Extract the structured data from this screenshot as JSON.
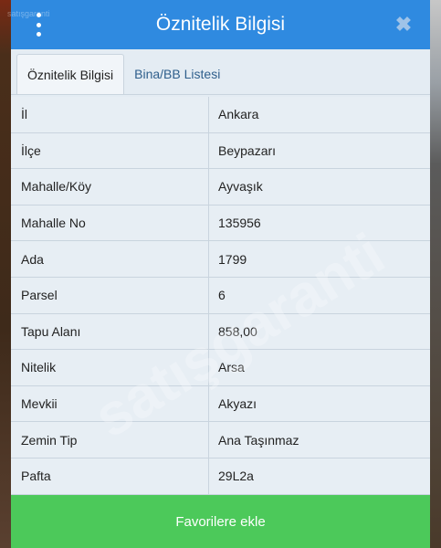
{
  "header": {
    "title": "Öznitelik Bilgisi",
    "close_glyph": "✖"
  },
  "tabs": [
    {
      "label": "Öznitelik Bilgisi"
    },
    {
      "label": "Bina/BB Listesi"
    }
  ],
  "rows": [
    {
      "key": "İl",
      "value": "Ankara"
    },
    {
      "key": "İlçe",
      "value": "Beypazarı"
    },
    {
      "key": "Mahalle/Köy",
      "value": "Ayvaşık"
    },
    {
      "key": "Mahalle No",
      "value": "135956"
    },
    {
      "key": "Ada",
      "value": "1799"
    },
    {
      "key": "Parsel",
      "value": "6"
    },
    {
      "key": "Tapu Alanı",
      "value": "858,00"
    },
    {
      "key": "Nitelik",
      "value": "Arsa"
    },
    {
      "key": "Mevkii",
      "value": "Akyazı"
    },
    {
      "key": "Zemin Tip",
      "value": "Ana Taşınmaz"
    },
    {
      "key": "Pafta",
      "value": "29L2a"
    }
  ],
  "footer": {
    "button_label": "Favorilere ekle"
  },
  "watermark": {
    "text": "satışgaranti",
    "corner_text": "satışgaranti"
  }
}
